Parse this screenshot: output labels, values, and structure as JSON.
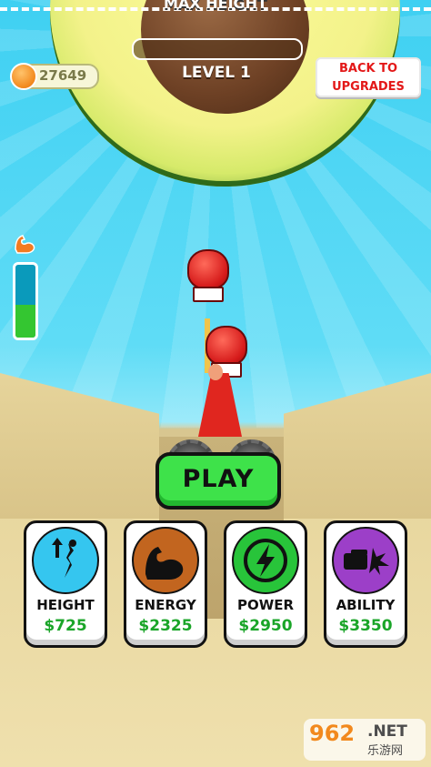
{
  "hud": {
    "max_height_label": "MAX HEIGHT",
    "level_label": "LEVEL 1",
    "level_progress": 0,
    "coins": "27649",
    "back_button": [
      "BACK TO",
      "UPGRADES"
    ],
    "energy_level": 0.45
  },
  "play_button": {
    "label": "PLAY"
  },
  "upgrades": [
    {
      "title": "HEIGHT",
      "price": "$725",
      "icon": "height-arrow-icon",
      "color": "#35c6ef"
    },
    {
      "title": "ENERGY",
      "price": "$2325",
      "icon": "flexed-arm-icon",
      "color": "#c2651f"
    },
    {
      "title": "POWER",
      "price": "$2950",
      "icon": "lightning-icon",
      "color": "#28c43a"
    },
    {
      "title": "ABILITY",
      "price": "$3350",
      "icon": "fist-impact-icon",
      "color": "#9c3fc8"
    }
  ],
  "watermark": {
    "digits": "962",
    "suffix": ".NET",
    "subtitle": "乐游网"
  }
}
